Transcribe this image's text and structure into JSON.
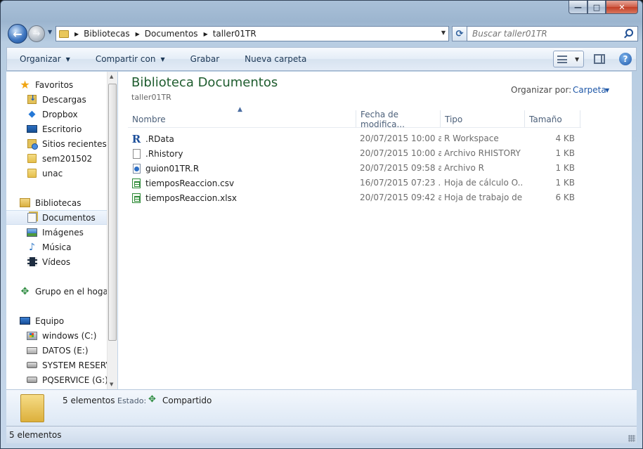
{
  "window": {
    "caption": {
      "minimize": "—",
      "maximize": "□",
      "close": "✕"
    }
  },
  "nav": {
    "back_glyph": "←",
    "forward_glyph": "→",
    "history_glyph": "▼",
    "refresh_glyph": "⟳",
    "dropdown_glyph": "▼"
  },
  "address": {
    "breadcrumbs": [
      "Bibliotecas",
      "Documentos",
      "taller01TR"
    ],
    "separator_glyph": "▶"
  },
  "search": {
    "placeholder": "Buscar taller01TR"
  },
  "toolbar": {
    "organize": "Organizar",
    "share_with": "Compartir con",
    "burn": "Grabar",
    "new_folder": "Nueva carpeta",
    "caret_glyph": "▼",
    "help_glyph": "?"
  },
  "sidebar": {
    "favorites": {
      "label": "Favoritos",
      "items": [
        "Descargas",
        "Dropbox",
        "Escritorio",
        "Sitios recientes",
        "sem201502",
        "unac"
      ]
    },
    "libraries": {
      "label": "Bibliotecas",
      "items": [
        "Documentos",
        "Imágenes",
        "Música",
        "Vídeos"
      ],
      "selected": "Documentos"
    },
    "homegroup": {
      "label": "Grupo en el hogar"
    },
    "computer": {
      "label": "Equipo",
      "items": [
        "windows (C:)",
        "DATOS (E:)",
        "SYSTEM RESERVED",
        "PQSERVICE (G:)"
      ]
    },
    "scroll_up_glyph": "▲",
    "scroll_down_glyph": "▼"
  },
  "library": {
    "title": "Biblioteca Documentos",
    "subtitle": "taller01TR",
    "arrange_label": "Organizar por:",
    "arrange_value": "Carpeta",
    "sort_glyph": "▲"
  },
  "columns": {
    "name": "Nombre",
    "date": "Fecha de modifica...",
    "type": "Tipo",
    "size": "Tamaño"
  },
  "files": [
    {
      "name": ".RData",
      "date": "20/07/2015 10:00 a...",
      "type": "R Workspace",
      "size": "4 KB",
      "icon": "r-workspace-icon"
    },
    {
      "name": ".Rhistory",
      "date": "20/07/2015 10:00 a...",
      "type": "Archivo RHISTORY",
      "size": "1 KB",
      "icon": "blank-file-icon"
    },
    {
      "name": "guion01TR.R",
      "date": "20/07/2015 09:58 a...",
      "type": "Archivo R",
      "size": "1 KB",
      "icon": "r-script-icon"
    },
    {
      "name": "tiemposReaccion.csv",
      "date": "16/07/2015 07:23 ...",
      "type": "Hoja de cálculo O...",
      "size": "1 KB",
      "icon": "spreadsheet-icon"
    },
    {
      "name": "tiemposReaccion.xlsx",
      "date": "20/07/2015 09:42 a...",
      "type": "Hoja de trabajo de...",
      "size": "6 KB",
      "icon": "spreadsheet-icon"
    }
  ],
  "details": {
    "count": "5 elementos",
    "state_label": "Estado:",
    "state_value": "Compartido"
  },
  "status_bar": {
    "text": "5 elementos"
  }
}
